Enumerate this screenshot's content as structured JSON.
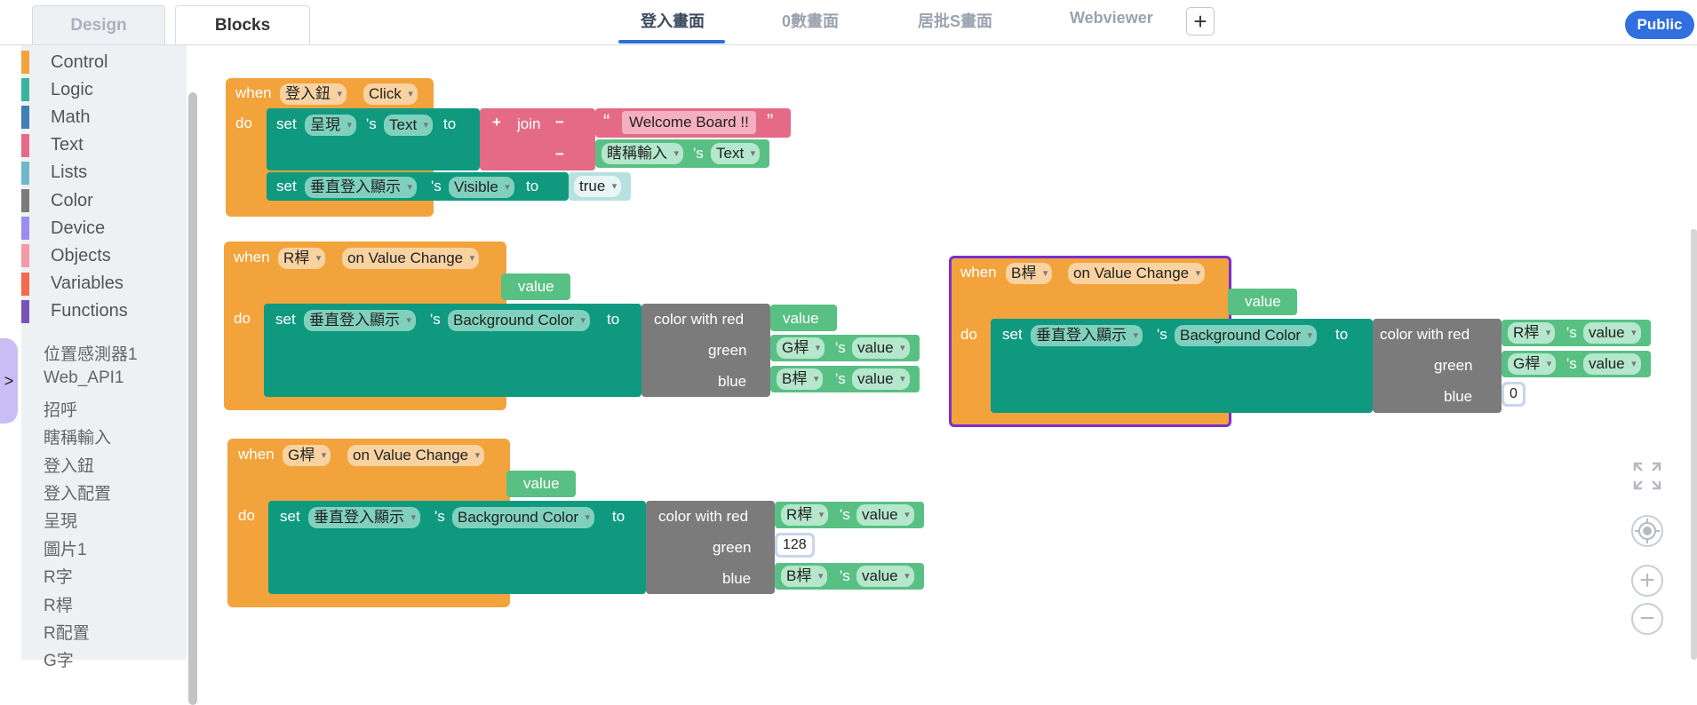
{
  "modes": {
    "design": "Design",
    "blocks": "Blocks"
  },
  "screens": [
    "登入畫面",
    "0數畫面",
    "居批S畫面",
    "Webviewer"
  ],
  "add_tab": "+",
  "public_label": "Public",
  "colors": {
    "event": "#f2a33c",
    "set": "#0f9a80",
    "text": "#e46a85",
    "color": "#7b7b7b",
    "value": "#59c084",
    "accent": "#2f6fe0",
    "selection": "#7a2fd0"
  },
  "categories": [
    {
      "label": "Control",
      "color": "#f2a33c"
    },
    {
      "label": "Logic",
      "color": "#38b39d"
    },
    {
      "label": "Math",
      "color": "#3f7fb6"
    },
    {
      "label": "Text",
      "color": "#e46a85"
    },
    {
      "label": "Lists",
      "color": "#6fb7c9"
    },
    {
      "label": "Color",
      "color": "#7b7b7b"
    },
    {
      "label": "Device",
      "color": "#9b8cf0"
    },
    {
      "label": "Objects",
      "color": "#f29aa6"
    },
    {
      "label": "Variables",
      "color": "#f26b4d"
    },
    {
      "label": "Functions",
      "color": "#7a52b8"
    }
  ],
  "components": [
    "位置感測器1",
    "Web_API1",
    "招呼",
    "瞎稱輸入",
    "登入鈕",
    "登入配置",
    "呈現",
    "圖片1",
    "R字",
    "R桿",
    "R配置",
    "G字"
  ],
  "kw": {
    "when": "when",
    "do": "do",
    "set": "set",
    "s": "'s",
    "to": "to",
    "join": "join",
    "color_with_red": "color with red",
    "green": "green",
    "blue": "blue",
    "plus": "+",
    "minus": "−",
    "lquote": "“",
    "rquote": "”"
  },
  "blocks": {
    "b1": {
      "component": "登入鈕",
      "event": "Click",
      "target1": "呈現",
      "prop1": "Text",
      "string": "Welcome Board !!",
      "src_comp": "瞎稱輸入",
      "src_prop": "Text",
      "target2": "垂直登入顯示",
      "prop2": "Visible",
      "bool": "true"
    },
    "b2": {
      "component": "R桿",
      "event": "on Value Change",
      "param": "value",
      "target": "垂直登入顯示",
      "prop": "Background Color",
      "red": "value",
      "green_comp": "G桿",
      "green_prop": "value",
      "blue_comp": "B桿",
      "blue_prop": "value"
    },
    "b3": {
      "component": "B桿",
      "event": "on Value Change",
      "param": "value",
      "target": "垂直登入顯示",
      "prop": "Background Color",
      "red_comp": "R桿",
      "red_prop": "value",
      "green_comp": "G桿",
      "green_prop": "value",
      "blue_num": "0"
    },
    "b4": {
      "component": "G桿",
      "event": "on Value Change",
      "param": "value",
      "target": "垂直登入顯示",
      "prop": "Background Color",
      "red_comp": "R桿",
      "red_prop": "value",
      "green_num": "128",
      "blue_comp": "B桿",
      "blue_prop": "value"
    }
  }
}
